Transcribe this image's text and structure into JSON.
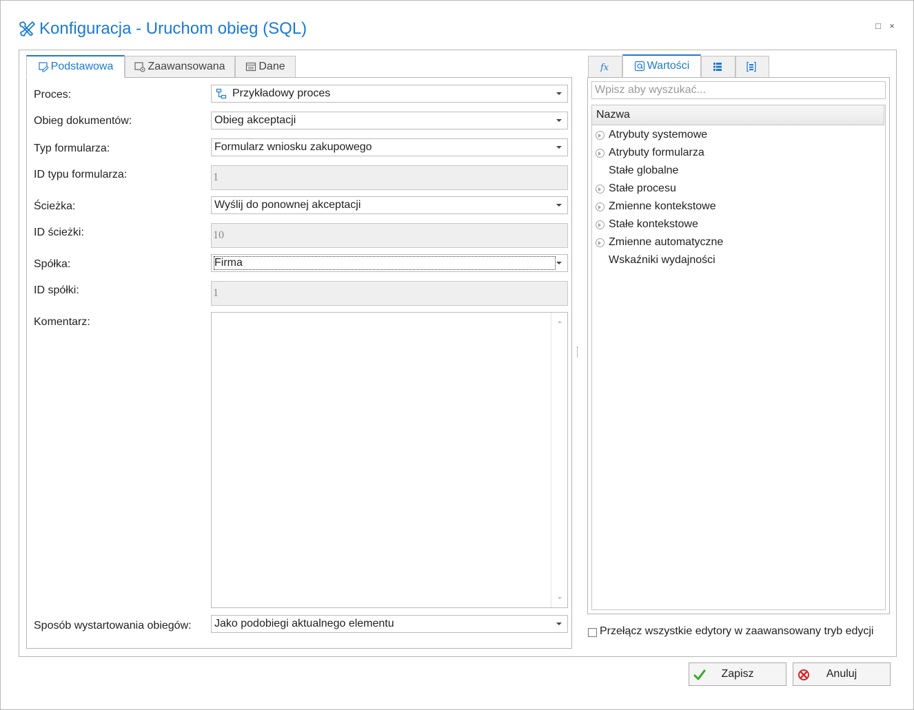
{
  "window": {
    "title": "Konfiguracja - Uruchom obieg (SQL)",
    "icon": "tools-icon",
    "controls": {
      "maximize": "□",
      "close": "×"
    }
  },
  "left_tabs": [
    {
      "label": "Podstawowa",
      "icon": "edit-form-icon",
      "active": true
    },
    {
      "label": "Zaawansowana",
      "icon": "settings-form-icon",
      "active": false
    },
    {
      "label": "Dane",
      "icon": "data-table-icon",
      "active": false
    }
  ],
  "form": {
    "proces": {
      "label": "Proces:",
      "value": "Przykładowy proces",
      "icon": "process-icon"
    },
    "obieg": {
      "label": "Obieg dokumentów:",
      "value": "Obieg akceptacji"
    },
    "typ_formularza": {
      "label": "Typ formularza:",
      "value": "Formularz wniosku zakupowego"
    },
    "id_typu": {
      "label": "ID typu formularza:",
      "value": "1"
    },
    "sciezka": {
      "label": "Ścieżka:",
      "value": "Wyślij do ponownej akceptacji"
    },
    "id_sciezki": {
      "label": "ID ścieżki:",
      "value": "10"
    },
    "spolka": {
      "label": "Spółka:",
      "value": "Firma"
    },
    "id_spolki": {
      "label": "ID spółki:",
      "value": "1"
    },
    "komentarz": {
      "label": "Komentarz:",
      "value": ""
    },
    "sposob": {
      "label": "Sposób wystartowania obiegów:",
      "value": "Jako podobiegi aktualnego elementu"
    }
  },
  "right_tabs": [
    {
      "label": "",
      "icon": "function-icon",
      "active": false
    },
    {
      "label": "Wartości",
      "icon": "values-icon",
      "active": true
    },
    {
      "label": "",
      "icon": "list-icon",
      "active": false
    },
    {
      "label": "",
      "icon": "form-fields-icon",
      "active": false
    }
  ],
  "values_panel": {
    "search_placeholder": "Wpisz aby wyszukać...",
    "column_header": "Nazwa",
    "items": [
      {
        "label": "Atrybuty systemowe",
        "expandable": true
      },
      {
        "label": "Atrybuty formularza",
        "expandable": true
      },
      {
        "label": "Stałe globalne",
        "expandable": false
      },
      {
        "label": "Stałe procesu",
        "expandable": true
      },
      {
        "label": "Zmienne kontekstowe",
        "expandable": true
      },
      {
        "label": "Stałe kontekstowe",
        "expandable": true
      },
      {
        "label": "Zmienne automatyczne",
        "expandable": true
      },
      {
        "label": "Wskaźniki wydajności",
        "expandable": false
      }
    ]
  },
  "advanced_toggle": {
    "label": "Przełącz wszystkie edytory w zaawansowany tryb edycji",
    "checked": false
  },
  "buttons": {
    "save": {
      "label": "Zapisz",
      "icon": "check-icon",
      "color": "#3aa829"
    },
    "cancel": {
      "label": "Anuluj",
      "icon": "cancel-icon",
      "color": "#d8232a"
    }
  },
  "colors": {
    "accent": "#1a7ad4"
  }
}
